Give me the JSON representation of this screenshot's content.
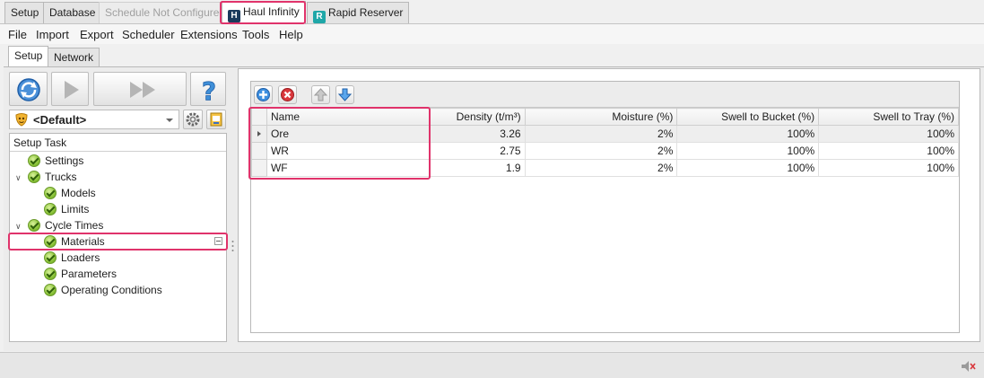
{
  "app_tabs": [
    {
      "label": "Setup"
    },
    {
      "label": "Database"
    },
    {
      "label": "Schedule Not Configured"
    },
    {
      "label": "Haul Infinity"
    },
    {
      "label": "Rapid Reserver"
    }
  ],
  "menu": [
    "File",
    "Import",
    "Export",
    "Scheduler",
    "Extensions",
    "Tools",
    "Help"
  ],
  "sub_tabs": [
    {
      "label": "Setup"
    },
    {
      "label": "Network"
    }
  ],
  "profile": {
    "selected": "<Default>"
  },
  "setup_task": {
    "header": "Setup Task",
    "items": [
      {
        "label": "Settings"
      },
      {
        "label": "Trucks"
      },
      {
        "label": "Models"
      },
      {
        "label": "Limits"
      },
      {
        "label": "Cycle Times"
      },
      {
        "label": "Materials"
      },
      {
        "label": "Loaders"
      },
      {
        "label": "Parameters"
      },
      {
        "label": "Operating Conditions"
      }
    ]
  },
  "grid": {
    "columns": [
      "Name",
      "Density (t/m³)",
      "Moisture (%)",
      "Swell to Bucket (%)",
      "Swell to Tray (%)"
    ],
    "rows": [
      [
        "Ore",
        "3.26",
        "2%",
        "100%",
        "100%"
      ],
      [
        "WR",
        "2.75",
        "2%",
        "100%",
        "100%"
      ],
      [
        "WF",
        "1.9",
        "2%",
        "100%",
        "100%"
      ]
    ]
  },
  "colors": {
    "highlight": "#e0336b",
    "accent_blue": "#2a7fd4",
    "haul_icon": "#1a3a5c",
    "rapid_icon": "#1fa7a8"
  },
  "icons": [
    "refresh-icon",
    "play-icon",
    "fast-forward-icon",
    "help-icon",
    "profile-mask-icon",
    "gear-icon",
    "notepad-icon",
    "add-icon",
    "delete-icon",
    "move-up-icon",
    "move-down-icon",
    "speaker-icon"
  ]
}
